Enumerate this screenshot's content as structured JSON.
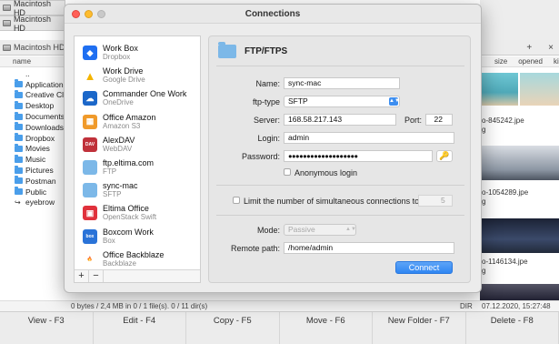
{
  "background": {
    "tabs": [
      "Macintosh HD",
      "Macintosh HD"
    ],
    "left_pane_title": "Macintosh HD",
    "left_column_header": "name",
    "left_files": [
      {
        "name": "..",
        "icon": "parent-icon"
      },
      {
        "name": "Application",
        "icon": "folder-icon"
      },
      {
        "name": "Creative Cl",
        "icon": "folder-icon"
      },
      {
        "name": "Desktop",
        "icon": "folder-icon"
      },
      {
        "name": "Documents",
        "icon": "folder-icon"
      },
      {
        "name": "Downloads",
        "icon": "folder-icon"
      },
      {
        "name": "Dropbox",
        "icon": "folder-icon"
      },
      {
        "name": "Movies",
        "icon": "folder-icon"
      },
      {
        "name": "Music",
        "icon": "folder-icon"
      },
      {
        "name": "Pictures",
        "icon": "folder-icon"
      },
      {
        "name": "Postman",
        "icon": "folder-icon"
      },
      {
        "name": "Public",
        "icon": "folder-icon"
      },
      {
        "name": "eyebrow",
        "icon": "symlink-icon"
      }
    ],
    "right_toolbar": {
      "add": "+",
      "close": "×"
    },
    "right_columns": [
      "size",
      "opened",
      "kin"
    ],
    "right_thumbs": [
      "o-845242.jpe\ng",
      "o-1054289.jpe\ng",
      "o-1146134.jpe\ng"
    ],
    "status_left": "0 bytes / 2,4 MB in 0 / 1 file(s). 0 / 11 dir(s)",
    "status_dir": "DIR",
    "status_date": "07.12.2020, 15:27:48",
    "fkeys": [
      "View - F3",
      "Edit - F4",
      "Copy - F5",
      "Move - F6",
      "New Folder - F7",
      "Delete - F8"
    ]
  },
  "dialog": {
    "title": "Connections",
    "services": [
      {
        "name": "Work Box",
        "sub": "Dropbox",
        "icon": "dropbox-icon"
      },
      {
        "name": "Work Drive",
        "sub": "Google Drive",
        "icon": "google-drive-icon"
      },
      {
        "name": "Commander One Work",
        "sub": "OneDrive",
        "icon": "onedrive-icon"
      },
      {
        "name": "Office Amazon",
        "sub": "Amazon S3",
        "icon": "amazon-s3-icon"
      },
      {
        "name": "AlexDAV",
        "sub": "WebDAV",
        "icon": "webdav-icon"
      },
      {
        "name": "ftp.eltima.com",
        "sub": "FTP",
        "icon": "ftp-folder-icon"
      },
      {
        "name": "sync-mac",
        "sub": "SFTP",
        "icon": "sftp-folder-icon"
      },
      {
        "name": "Eltima Office",
        "sub": "OpenStack Swift",
        "icon": "openstack-icon"
      },
      {
        "name": "Boxcom Work",
        "sub": "Box",
        "icon": "box-icon"
      },
      {
        "name": "Office Backblaze",
        "sub": "Backblaze",
        "icon": "backblaze-icon"
      }
    ],
    "add_label": "+",
    "remove_label": "−",
    "panel_title": "FTP/FTPS",
    "labels": {
      "name": "Name:",
      "ftp_type": "ftp-type",
      "server": "Server:",
      "port": "Port:",
      "login": "Login:",
      "password": "Password:",
      "anonymous": "Anonymous login",
      "limit": "Limit the number of simultaneous connections to",
      "mode": "Mode:",
      "remote_path": "Remote path:"
    },
    "values": {
      "name": "sync-mac",
      "ftp_type": "SFTP",
      "server": "168.58.217.143",
      "port": "22",
      "login": "admin",
      "password": "●●●●●●●●●●●●●●●●●●●",
      "limit": "5",
      "mode": "Passive",
      "remote_path": "/home/admin"
    },
    "key_icon": "🔑",
    "connect_label": "Connect"
  },
  "colors": {
    "accent": "#2f86f2",
    "close": "#ff5f57",
    "minimize": "#febc2e"
  }
}
